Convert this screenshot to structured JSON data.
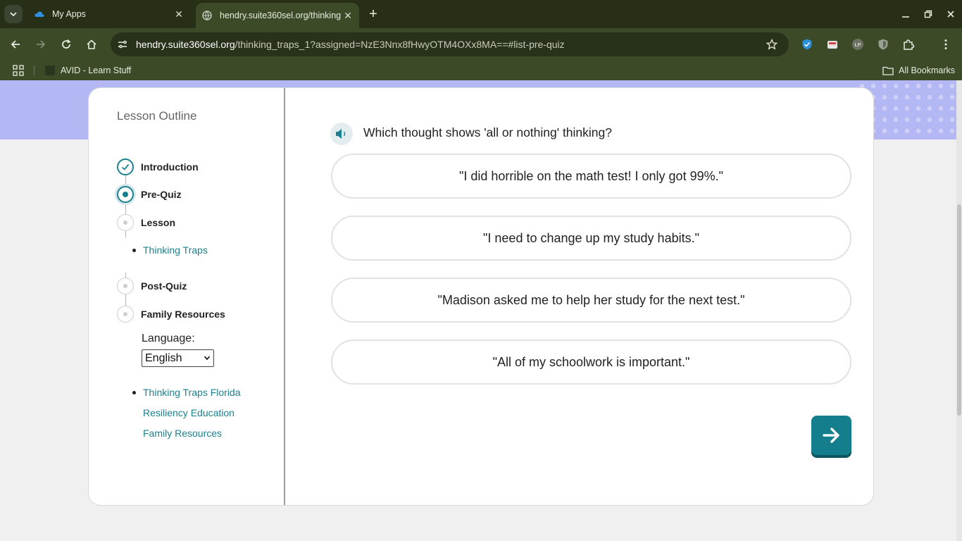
{
  "browser": {
    "tabs": [
      {
        "title": "My Apps",
        "active": false
      },
      {
        "title": "hendry.suite360sel.org/thinking_traps_1?assigned=NzE3Nnx8fHwyOTM4OXx8MA==",
        "active": true
      }
    ],
    "url_host": "hendry.suite360sel.org",
    "url_path": "/thinking_traps_1?assigned=NzE3Nnx8fHwyOTM4OXx8MA==#list-pre-quiz",
    "bookmarks": [
      {
        "label": "AVID - Learn Stuff"
      }
    ],
    "all_bookmarks_label": "All Bookmarks",
    "colors": {
      "frame": "#273017",
      "toolbar": "#3d4a28",
      "omnibox": "#28311a"
    }
  },
  "sidebar": {
    "title": "Lesson Outline",
    "steps": [
      {
        "label": "Introduction",
        "state": "done"
      },
      {
        "label": "Pre-Quiz",
        "state": "current"
      },
      {
        "label": "Lesson",
        "state": "pending"
      },
      {
        "label": "Post-Quiz",
        "state": "pending"
      },
      {
        "label": "Family Resources",
        "state": "pending"
      }
    ],
    "lesson_subitems": [
      "Thinking Traps"
    ],
    "language_label": "Language:",
    "language_selected": "English",
    "resources": [
      "Thinking Traps Florida",
      "Resiliency Education",
      "Family Resources"
    ]
  },
  "quiz": {
    "question": "Which thought shows 'all or nothing' thinking?",
    "answers": [
      "\"I did horrible on the math test! I only got 99%.\"",
      "\"I need to change up my study habits.\"",
      "\"Madison asked me to help her study for the next test.\"",
      "\"All of my schoolwork is important.\""
    ],
    "next_icon": "arrow-right-icon"
  },
  "theme": {
    "accent": "#1a7f8e",
    "banner": "#b3b7f3"
  }
}
